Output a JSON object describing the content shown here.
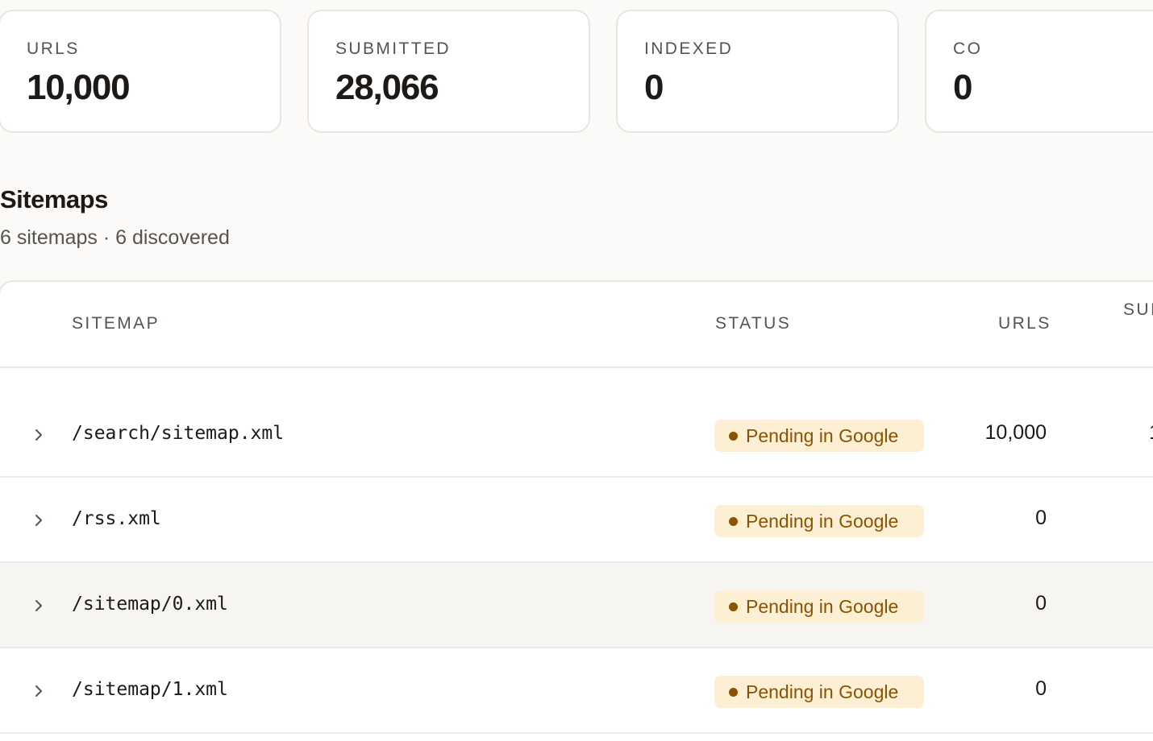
{
  "stats": [
    {
      "label": "URLS",
      "value": "10,000"
    },
    {
      "label": "SUBMITTED",
      "value": "28,066"
    },
    {
      "label": "INDEXED",
      "value": "0"
    },
    {
      "label": "CO",
      "value": "0"
    }
  ],
  "sitemaps_section": {
    "title": "Sitemaps",
    "subtitle": "6 sitemaps · 6 discovered"
  },
  "table": {
    "columns": {
      "sitemap": "SITEMAP",
      "status": "STATUS",
      "urls": "URLS",
      "submitted": "SUI"
    },
    "rows": [
      {
        "name": "/search/sitemap.xml",
        "status": "Pending in Google",
        "urls": "10,000",
        "submitted": "1"
      },
      {
        "name": "/rss.xml",
        "status": "Pending in Google",
        "urls": "0",
        "submitted": ""
      },
      {
        "name": "/sitemap/0.xml",
        "status": "Pending in Google",
        "urls": "0",
        "submitted": ""
      },
      {
        "name": "/sitemap/1.xml",
        "status": "Pending in Google",
        "urls": "0",
        "submitted": ""
      }
    ]
  },
  "colors": {
    "background": "#fcfaf8",
    "pending_badge_bg": "#fcefd4",
    "pending_badge_text": "#8a5300",
    "row_hover": "#f7f5f2"
  },
  "icons": {
    "row_expand": "chevron-right-icon",
    "status_dot": "status-dot-icon"
  }
}
